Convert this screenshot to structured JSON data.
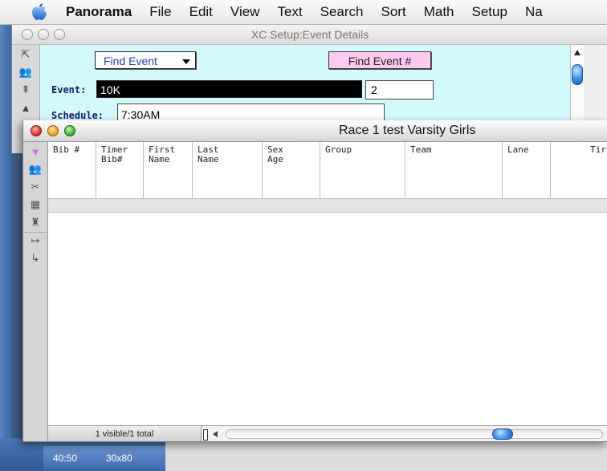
{
  "menubar": {
    "app": "Panorama",
    "items": [
      "File",
      "Edit",
      "View",
      "Text",
      "Search",
      "Sort",
      "Math",
      "Setup",
      "Na"
    ]
  },
  "back_window": {
    "title": "XC Setup:Event Details",
    "find_event_label": "Find Event",
    "find_event_num_label": "Find Event #",
    "event_label": "Event:",
    "event_value": "10K",
    "event_number": "2",
    "schedule_label": "Schedule:",
    "schedule_value": "7:30AM"
  },
  "front_window": {
    "title": "Race 1 test Varsity Girls",
    "columns": [
      "Bib #",
      "Timer\nBib#",
      "First\nName",
      "Last\nName",
      "Sex\nAge",
      "Group",
      "Team",
      "Lane",
      "Tir"
    ],
    "status": "1 visible/1 total"
  },
  "desktop_status": {
    "time": "40:50",
    "size": "30x80"
  },
  "colors": {
    "form_bg": "#d3f9fd",
    "find_event_num_bg": "#ffc9f1",
    "find_event_text": "#1a3fc0",
    "field_label": "#0c1f6e"
  }
}
